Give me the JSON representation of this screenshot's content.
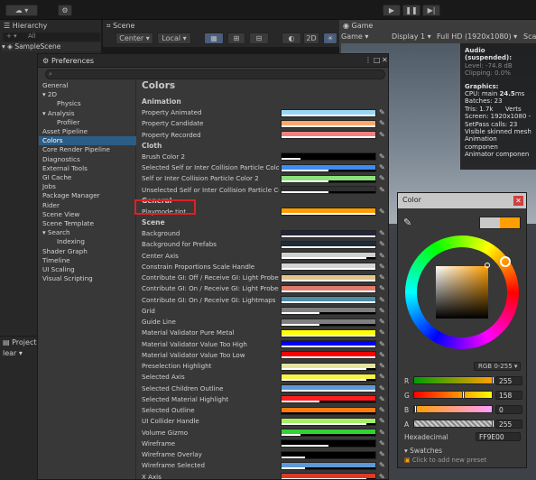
{
  "topbar": {
    "account_label": "☁ ▾",
    "cloud_icon": "cloud-icon",
    "gear_icon": "gear-icon"
  },
  "hierarchy": {
    "tab_label": "Hierarchy",
    "search_placeholder": "All",
    "scene_name": "SampleScene"
  },
  "scene": {
    "tab_label": "Scene",
    "pivot_label": "Center",
    "space_label": "Local",
    "toggle_2d": "2D"
  },
  "game": {
    "tab_label": "Game",
    "view_label": "Game",
    "display_label": "Display 1",
    "resolution_label": "Full HD (1920x1080)",
    "scale_label": "Sca"
  },
  "stats": {
    "audio_title": "Audio (suspended):",
    "audio_level": "Level: -74.8 dB",
    "audio_clipping": "Clipping: 0.0%",
    "graphics_title": "Graphics:",
    "cpu_prefix": "CPU: main ",
    "cpu_value": "24.5",
    "cpu_suffix": "ms",
    "batches": "Batches: 23",
    "tris": "Tris: 1.7k",
    "verts": "Verts",
    "screen": "Screen: 1920x1080 -",
    "setpass": "SetPass calls: 23",
    "skinned": "Visible skinned mesh",
    "anim_comp": "Animation componen",
    "animator_comp": "Animator componen"
  },
  "console": {
    "tab_label": "Project",
    "clear_label": "lear"
  },
  "preferences": {
    "title": "Preferences",
    "heading": "Colors",
    "nav": [
      {
        "label": "General",
        "indent": 0
      },
      {
        "label": "2D",
        "indent": 0,
        "arrow": "▾"
      },
      {
        "label": "Physics",
        "indent": 2
      },
      {
        "label": "Analysis",
        "indent": 0,
        "arrow": "▾"
      },
      {
        "label": "Profiler",
        "indent": 2
      },
      {
        "label": "Asset Pipeline",
        "indent": 0
      },
      {
        "label": "Colors",
        "indent": 0,
        "selected": true
      },
      {
        "label": "Core Render Pipeline",
        "indent": 0
      },
      {
        "label": "Diagnostics",
        "indent": 0
      },
      {
        "label": "External Tools",
        "indent": 0
      },
      {
        "label": "GI Cache",
        "indent": 0
      },
      {
        "label": "Jobs",
        "indent": 0
      },
      {
        "label": "Package Manager",
        "indent": 0
      },
      {
        "label": "Rider",
        "indent": 0
      },
      {
        "label": "Scene View",
        "indent": 0
      },
      {
        "label": "Scene Template",
        "indent": 0
      },
      {
        "label": "Search",
        "indent": 0,
        "arrow": "▾"
      },
      {
        "label": "Indexing",
        "indent": 2
      },
      {
        "label": "Shader Graph",
        "indent": 0
      },
      {
        "label": "Timeline",
        "indent": 0
      },
      {
        "label": "UI Scaling",
        "indent": 0
      },
      {
        "label": "Visual Scripting",
        "indent": 0
      }
    ],
    "sections": [
      {
        "header": "Animation",
        "rows": [
          {
            "label": "Property Animated",
            "color": "#99d6f3",
            "alpha": 1.0
          },
          {
            "label": "Property Candidate",
            "color": "#f9a96c",
            "alpha": 1.0
          },
          {
            "label": "Property Recorded",
            "color": "#f08080",
            "alpha": 1.0
          }
        ]
      },
      {
        "header": "Cloth",
        "rows": [
          {
            "label": "Brush Color 2",
            "color": "#000000",
            "alpha": 0.2
          },
          {
            "label": "Selected Self or Inter Collision Particle Color",
            "color": "#3d8cf0",
            "alpha": 0.5
          },
          {
            "label": "Self or Inter Collision Particle Color 2",
            "color": "#8ae27b",
            "alpha": 0.5
          },
          {
            "label": "Unselected Self or Inter Collision Particle Col",
            "color": "#303030",
            "alpha": 0.5
          }
        ]
      },
      {
        "header": "General",
        "rows": [
          {
            "label": "Playmode tint",
            "color": "#ff9e00",
            "alpha": 1.0
          }
        ]
      },
      {
        "header": "Scene",
        "rows": [
          {
            "label": "Background",
            "color": "#23263a",
            "alpha": 1.0
          },
          {
            "label": "Background for Prefabs",
            "color": "#1d2c3b",
            "alpha": 1.0
          },
          {
            "label": "Center Axis",
            "color": "#d0d0d0",
            "alpha": 0.9
          },
          {
            "label": "Constrain Proportions Scale Handle",
            "color": "#d4d4d4",
            "alpha": 1.0
          },
          {
            "label": "Contribute GI: Off / Receive GI: Light Probes",
            "color": "#e1c689",
            "alpha": 1.0
          },
          {
            "label": "Contribute GI: On / Receive GI: Light Probes",
            "color": "#e07a6a",
            "alpha": 1.0
          },
          {
            "label": "Contribute GI: On / Receive GI: Lightmaps",
            "color": "#4c8ea6",
            "alpha": 1.0
          },
          {
            "label": "Grid",
            "color": "#7f7f7f",
            "alpha": 0.4
          },
          {
            "label": "Guide Line",
            "color": "#7f7f7f",
            "alpha": 0.4
          },
          {
            "label": "Material Validator Pure Metal",
            "color": "#ffff00",
            "alpha": 1.0
          },
          {
            "label": "Material Validator Value Too High",
            "color": "#0000ff",
            "alpha": 1.0
          },
          {
            "label": "Material Validator Value Too Low",
            "color": "#ff0000",
            "alpha": 1.0
          },
          {
            "label": "Preselection Highlight",
            "color": "#e5e5a0",
            "alpha": 0.9
          },
          {
            "label": "Selected Axis",
            "color": "#f6f24a",
            "alpha": 0.9
          },
          {
            "label": "Selected Children Outline",
            "color": "#5e98d6",
            "alpha": 1.0
          },
          {
            "label": "Selected Material Highlight",
            "color": "#ff1e1e",
            "alpha": 0.4
          },
          {
            "label": "Selected Outline",
            "color": "#ff7a10",
            "alpha": 0.0
          },
          {
            "label": "UI Collider Handle",
            "color": "#a6ee6a",
            "alpha": 0.9
          },
          {
            "label": "Volume Gizmo",
            "color": "#33d233",
            "alpha": 0.2
          },
          {
            "label": "Wireframe",
            "color": "#000000",
            "alpha": 0.5
          },
          {
            "label": "Wireframe Overlay",
            "color": "#000000",
            "alpha": 0.25
          },
          {
            "label": "Wireframe Selected",
            "color": "#5e98d6",
            "alpha": 0.25
          },
          {
            "label": "X Axis",
            "color": "#db3b26",
            "alpha": 0.9
          }
        ]
      }
    ]
  },
  "color_picker": {
    "title": "Color",
    "mode": "RGB 0-255 ▾",
    "current_color": "#ff9e00",
    "previous_color": "#c8c8c8",
    "channels": [
      {
        "label": "R",
        "value": "255"
      },
      {
        "label": "G",
        "value": "158"
      },
      {
        "label": "B",
        "value": "0"
      },
      {
        "label": "A",
        "value": "255"
      }
    ],
    "hex_label": "Hexadecimal",
    "hex_value": "FF9E00",
    "swatches_label": "▾ Swatches",
    "add_preset": "Click to add new preset"
  }
}
